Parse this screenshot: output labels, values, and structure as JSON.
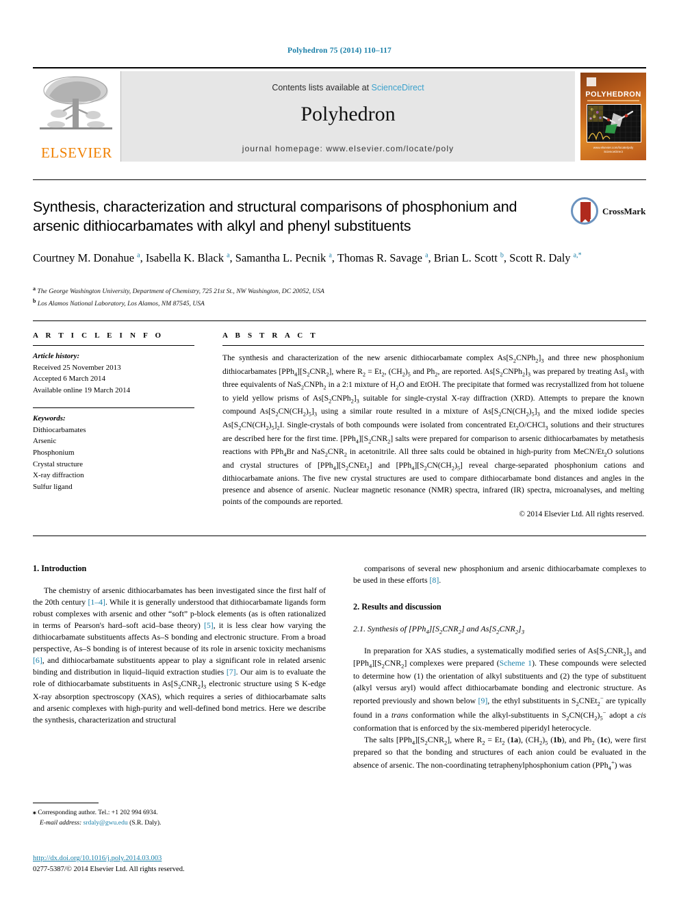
{
  "running_head": "Polyhedron 75 (2014) 110–117",
  "masthead": {
    "publisher_logo_text": "ELSEVIER",
    "contents_prefix": "Contents lists available at ",
    "contents_link": "ScienceDirect",
    "journal_name": "Polyhedron",
    "homepage": "journal homepage: www.elsevier.com/locate/poly",
    "cover_title": "POLYHEDRON",
    "cover_footer": "www.elsevier.com/locate/poly\nScienceDirect"
  },
  "article": {
    "title": "Synthesis, characterization and structural comparisons of phosphonium and arsenic dithiocarbamates with alkyl and phenyl substituents",
    "crossmark_label": "CrossMark",
    "authors_html": "Courtney M. Donahue <sup>a</sup>, Isabella K. Black <sup>a</sup>, Samantha L. Pecnik <sup>a</sup>, Thomas R. Savage <sup>a</sup>, Brian L. Scott <sup>b</sup>, Scott R. Daly <sup>a,*</sup>",
    "affiliations": [
      "The George Washington University, Department of Chemistry, 725 21st St., NW Washington, DC 20052, USA",
      "Los Alamos National Laboratory, Los Alamos, NM 87545, USA"
    ],
    "affiliation_marks": [
      "a",
      "b"
    ]
  },
  "article_info": {
    "heading": "A R T I C L E   I N F O",
    "history_label": "Article history:",
    "history": [
      "Received 25 November 2013",
      "Accepted 6 March 2014",
      "Available online 19 March 2014"
    ],
    "keywords_label": "Keywords:",
    "keywords": [
      "Dithiocarbamates",
      "Arsenic",
      "Phosphonium",
      "Crystal structure",
      "X-ray diffraction",
      "Sulfur ligand"
    ]
  },
  "abstract": {
    "heading": "A B S T R A C T",
    "text_html": "The synthesis and characterization of the new arsenic dithiocarbamate complex As[S<sub>2</sub>CNPh<sub>2</sub>]<sub>3</sub> and three new phosphonium dithiocarbamates [PPh<sub>4</sub>][S<sub>2</sub>CNR<sub>2</sub>], where R<sub>2</sub> = Et<sub>2</sub>, (CH<sub>2</sub>)<sub>5</sub> and Ph<sub>2</sub>, are reported. As[S<sub>2</sub>CNPh<sub>2</sub>]<sub>3</sub> was prepared by treating AsI<sub>3</sub> with three equivalents of NaS<sub>2</sub>CNPh<sub>2</sub> in a 2:1 mixture of H<sub>2</sub>O and EtOH. The precipitate that formed was recrystallized from hot toluene to yield yellow prisms of As[S<sub>2</sub>CNPh<sub>2</sub>]<sub>3</sub> suitable for single-crystal X-ray diffraction (XRD). Attempts to prepare the known compound As[S<sub>2</sub>CN(CH<sub>2</sub>)<sub>5</sub>]<sub>3</sub> using a similar route resulted in a mixture of As[S<sub>2</sub>CN(CH<sub>2</sub>)<sub>5</sub>]<sub>3</sub> and the mixed iodide species As[S<sub>2</sub>CN(CH<sub>2</sub>)<sub>5</sub>]<sub>2</sub>I. Single-crystals of both compounds were isolated from concentrated Et<sub>2</sub>O/CHCl<sub>3</sub> solutions and their structures are described here for the first time. [PPh<sub>4</sub>][S<sub>2</sub>CNR<sub>2</sub>] salts were prepared for comparison to arsenic dithiocarbamates by metathesis reactions with PPh<sub>4</sub>Br and NaS<sub>2</sub>CNR<sub>2</sub> in acetonitrile. All three salts could be obtained in high-purity from MeCN/Et<sub>2</sub>O solutions and crystal structures of [PPh<sub>4</sub>][S<sub>2</sub>CNEt<sub>2</sub>] and [PPh<sub>4</sub>][S<sub>2</sub>CN(CH<sub>2</sub>)<sub>5</sub>] reveal charge-separated phosphonium cations and dithiocarbamate anions. The five new crystal structures are used to compare dithiocarbamate bond distances and angles in the presence and absence of arsenic. Nuclear magnetic resonance (NMR) spectra, infrared (IR) spectra, microanalyses, and melting points of the compounds are reported.",
    "copyright": "© 2014 Elsevier Ltd. All rights reserved."
  },
  "body": {
    "left": {
      "section1_heading": "1. Introduction",
      "para1_html": "The chemistry of arsenic dithiocarbamates has been investigated since the first half of the 20th century <span class=\"ref\">[1–4]</span>. While it is generally understood that dithiocarbamate ligands form robust complexes with arsenic and other “soft” p-block elements (as is often rationalized in terms of Pearson's hard–soft acid–base theory) <span class=\"ref\">[5]</span>, it is less clear how varying the dithiocarbamate substituents affects As–S bonding and electronic structure. From a broad perspective, As–S bonding is of interest because of its role in arsenic toxicity mechanisms <span class=\"ref\">[6]</span>, and dithiocarbamate substituents appear to play a significant role in related arsenic binding and distribution in liquid–liquid extraction studies <span class=\"ref\">[7]</span>. Our aim is to evaluate the role of dithiocarbamate substituents in As[S<sub>2</sub>CNR<sub>2</sub>]<sub>3</sub> electronic structure using S K-edge X-ray absorption spectroscopy (XAS), which requires a series of dithiocarbamate salts and arsenic complexes with high-purity and well-defined bond metrics. Here we describe the synthesis, characterization and structural"
    },
    "right": {
      "para_cont_html": "comparisons of several new phosphonium and arsenic dithiocarbamate complexes to be used in these efforts <span class=\"ref\">[8]</span>.",
      "section2_heading": "2. Results and discussion",
      "subsection_heading_html": "2.1. Synthesis of [PPh<sub>4</sub>][S<sub>2</sub>CNR<sub>2</sub>] and As[S<sub>2</sub>CNR<sub>2</sub>]<sub>3</sub>",
      "para1_html": "In preparation for XAS studies, a systematically modified series of As[S<sub>2</sub>CNR<sub>2</sub>]<sub>3</sub> and [PPh<sub>4</sub>][S<sub>2</sub>CNR<sub>2</sub>] complexes were prepared (<span class=\"ref\">Scheme 1</span>). These compounds were selected to determine how (1) the orientation of alkyl substituents and (2) the type of substituent (alkyl versus aryl) would affect dithiocarbamate bonding and electronic structure. As reported previously and shown below <span class=\"ref\">[9]</span>, the ethyl substituents in S<sub>2</sub>CNEt<sub>2</sub><sup class=\"ss\">−</sup> are typically found in a <i>trans</i> conformation while the alkyl-substituents in S<sub>2</sub>CN(CH<sub>2</sub>)<sub>5</sub><sup class=\"ss\">−</sup> adopt a <i>cis</i> conformation that is enforced by the six-membered piperidyl heterocycle.",
      "para2_html": "The salts [PPh<sub>4</sub>][S<sub>2</sub>CNR<sub>2</sub>], where R<sub>2</sub> = Et<sub>2</sub> (<b>1a</b>), (CH<sub>2</sub>)<sub>5</sub> (<b>1b</b>), and Ph<sub>2</sub> (<b>1c</b>), were first prepared so that the bonding and structures of each anion could be evaluated in the absence of arsenic. The non-coordinating tetraphenylphosphonium cation (PPh<sub>4</sub><sup class=\"ss\">+</sup>) was"
    }
  },
  "footnote": {
    "corresponding_html": "<span style=\"font-weight:bold\">⁎</span> Corresponding author. Tel.: +1 202 994 6934.",
    "email_label": "E-mail address:",
    "email": "srdaly@gwu.edu",
    "email_owner": "(S.R. Daly)."
  },
  "doi_block": {
    "doi_url": "http://dx.doi.org/10.1016/j.poly.2014.03.003",
    "issn_line": "0277-5387/© 2014 Elsevier Ltd. All rights reserved."
  },
  "colors": {
    "link_blue": "#1a7fa8",
    "sciencedirect_blue": "#3aa1cc",
    "elsevier_orange": "#f08000",
    "band_gray": "#e6e6e6"
  }
}
